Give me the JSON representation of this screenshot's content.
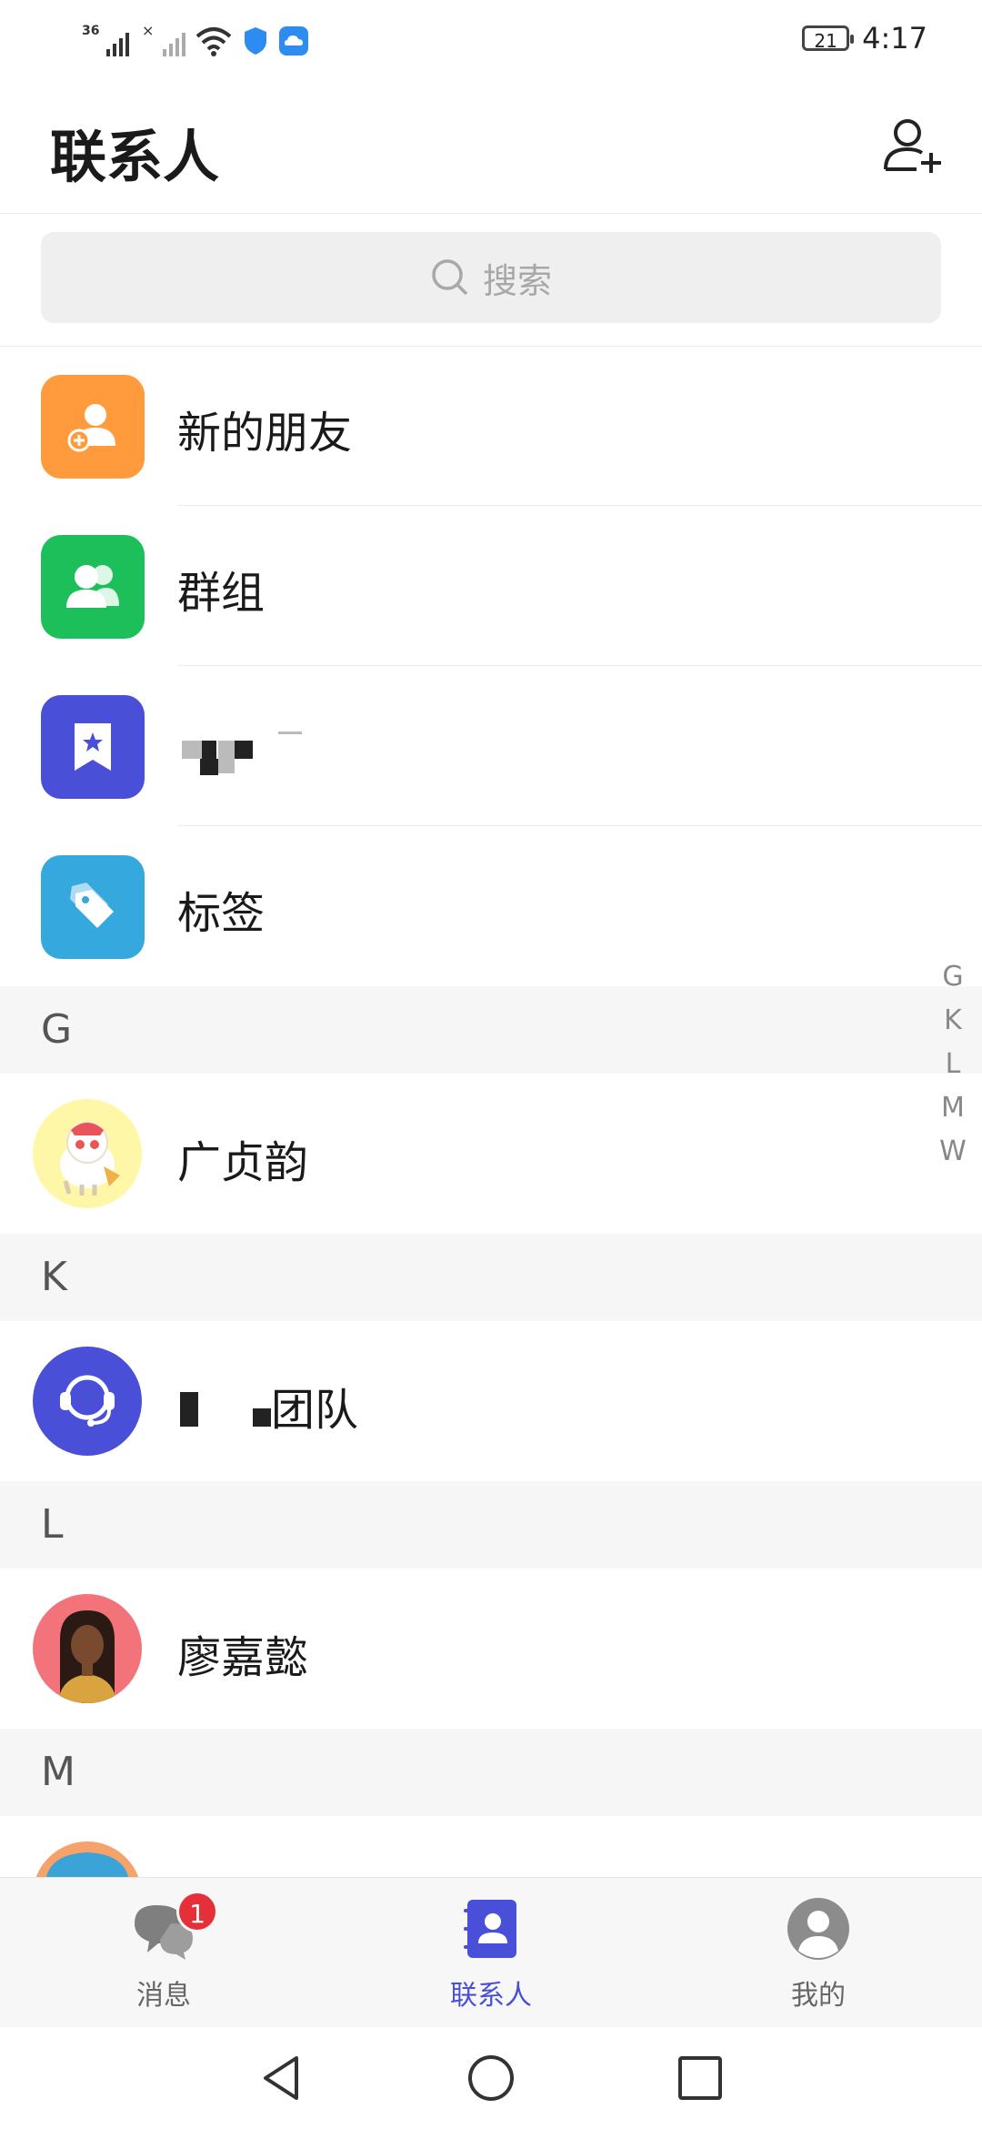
{
  "status_bar": {
    "network_label": "36",
    "battery_level": "21",
    "time": "4:17"
  },
  "header": {
    "title": "联系人",
    "add_contact_icon": "person-add-icon"
  },
  "search": {
    "placeholder": "搜索",
    "icon": "search-icon"
  },
  "features": [
    {
      "label": "新的朋友",
      "icon": "new-friend-icon",
      "color": "#FF9B3D"
    },
    {
      "label": "群组",
      "icon": "group-icon",
      "color": "#1DBF5A"
    },
    {
      "label": "",
      "icon": "bookmark-star-icon",
      "color": "#4A4FD8"
    },
    {
      "label": "标签",
      "icon": "tag-icon",
      "color": "#35A8DD"
    }
  ],
  "sections": [
    {
      "letter": "G",
      "contacts": [
        {
          "name": "广贞韵"
        }
      ]
    },
    {
      "letter": "K",
      "contacts": [
        {
          "name": "团队"
        }
      ]
    },
    {
      "letter": "L",
      "contacts": [
        {
          "name": "廖嘉懿"
        }
      ]
    },
    {
      "letter": "M",
      "contacts": [
        {
          "name": ""
        }
      ]
    }
  ],
  "alphabet_index": [
    "G",
    "K",
    "L",
    "M",
    "W"
  ],
  "bottom_nav": [
    {
      "label": "消息",
      "icon": "chat-bubbles-icon",
      "badge": "1",
      "active": false
    },
    {
      "label": "联系人",
      "icon": "contacts-book-icon",
      "active": true
    },
    {
      "label": "我的",
      "icon": "profile-icon",
      "active": false
    }
  ],
  "colors": {
    "accent": "#4A4FD8",
    "badge": "#E5303A"
  }
}
